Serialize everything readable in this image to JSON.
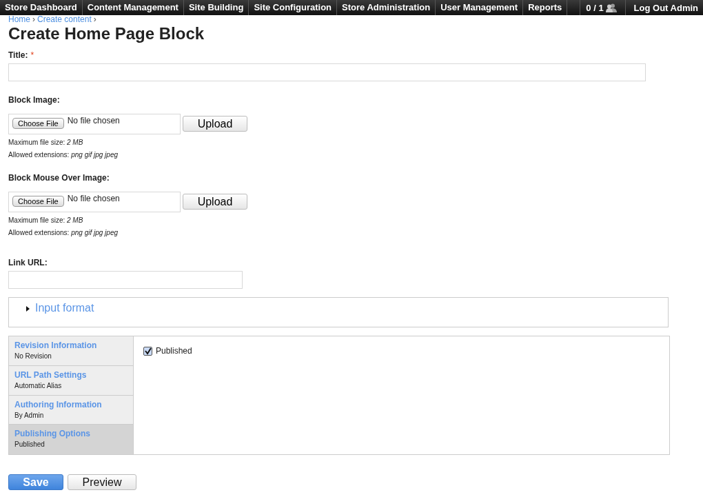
{
  "toolbar": {
    "menu": [
      {
        "label": "Store Dashboard"
      },
      {
        "label": "Content Management"
      },
      {
        "label": "Site Building"
      },
      {
        "label": "Site Configuration"
      },
      {
        "label": "Store Administration"
      },
      {
        "label": "User Management"
      },
      {
        "label": "Reports"
      }
    ],
    "counter": "0 / 1",
    "logout": "Log Out Admin"
  },
  "breadcrumb": {
    "items": [
      "Home",
      "Create content"
    ],
    "separator": "›"
  },
  "page_title": "Create Home Page Block",
  "title_field": {
    "label": "Title:",
    "required": true,
    "required_mark": "*"
  },
  "uploads": [
    {
      "label": "Block Image:",
      "choose_button": "Choose File",
      "file_status": "No file chosen",
      "upload_button": "Upload",
      "notes": [
        "Maximum file size: *2 MB*",
        "Allowed extensions: *png gif jpg jpeg*"
      ]
    },
    {
      "label": "Block Mouse Over Image:",
      "choose_button": "Choose File",
      "file_status": "No file chosen",
      "upload_button": "Upload",
      "notes": [
        "Maximum file size: *2 MB*",
        "Allowed extensions: *png gif jpg jpeg*"
      ]
    }
  ],
  "link_url": {
    "label": "Link URL:"
  },
  "input_format": {
    "label": "Input format",
    "expanded": false
  },
  "vertical_tabs": [
    {
      "title": "Revision Information",
      "summary": "No Revision",
      "selected": false
    },
    {
      "title": "URL Path Settings",
      "summary": "Automatic Alias",
      "selected": false
    },
    {
      "title": "Authoring Information",
      "summary": "By Admin",
      "selected": false
    },
    {
      "title": "Publishing Options",
      "summary": "Published",
      "selected": true
    }
  ],
  "publishing": {
    "label": "Published",
    "checked": true
  },
  "buttons": [
    {
      "label": "Save",
      "kind": "primary"
    },
    {
      "label": "Preview",
      "kind": "secondary"
    }
  ]
}
